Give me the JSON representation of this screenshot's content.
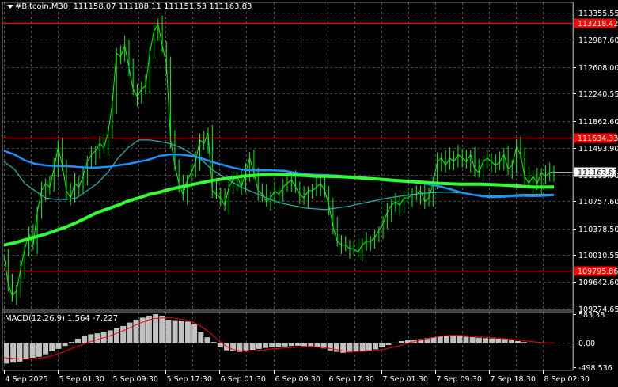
{
  "header": {
    "symbol": "#Bitcoin,M30",
    "ohlc": "111158.07 111188.11 111151.53 111163.83"
  },
  "macd_panel": {
    "label": "MACD(12,26,9) 1.564 -7.227"
  },
  "colors": {
    "background": "#000000",
    "grid": "#c0c0c0",
    "price": "#00ff00",
    "ma_fast": "#1e90ff",
    "ma_mid": "#20b2aa",
    "ma_slow": "#32ff32",
    "level": "#ff0000",
    "macd_hist": "#c0c0c0",
    "macd_signal": "#ff0000"
  },
  "chart_data": [
    {
      "type": "line",
      "name": "price",
      "y_ticks": [
        "113355.55",
        "112987.60",
        "112608.00",
        "112240.55",
        "111862.60",
        "111493.90",
        "111115.90",
        "110757.60",
        "110378.50",
        "110010.55",
        "109642.60",
        "109274.65"
      ],
      "y_tick_values": [
        113355.55,
        112987.6,
        112608.0,
        112240.55,
        111862.6,
        111493.9,
        111115.9,
        110757.6,
        110378.5,
        110010.55,
        109642.6,
        109274.65
      ],
      "ylim": [
        109250,
        113500
      ],
      "x_labels": [
        "4 Sep 2025",
        "5 Sep 01:30",
        "5 Sep 09:30",
        "5 Sep 17:30",
        "6 Sep 01:30",
        "6 Sep 09:30",
        "6 Sep 17:30",
        "7 Sep 01:30",
        "7 Sep 09:30",
        "7 Sep 18:30",
        "8 Sep 02:30"
      ],
      "current_price": "111163.83",
      "current_price_value": 111163.83,
      "levels": [
        {
          "label": "113218.42",
          "value": 113218.42
        },
        {
          "label": "111634.33",
          "value": 111634.33
        },
        {
          "label": "109795.86",
          "value": 109795.86
        }
      ],
      "close_series": [
        110000,
        109620,
        109450,
        109520,
        109820,
        110100,
        110300,
        110150,
        110600,
        110900,
        111000,
        110950,
        111200,
        111500,
        111250,
        110900,
        110800,
        111000,
        110950,
        111100,
        111300,
        111400,
        111450,
        111550,
        111500,
        111700,
        112100,
        112800,
        112750,
        112900,
        112600,
        112300,
        112200,
        112300,
        112350,
        112800,
        113100,
        113200,
        112900,
        112650,
        111600,
        111250,
        111000,
        110850,
        111050,
        111150,
        111300,
        111600,
        111550,
        111700,
        110900,
        110850,
        110800,
        110700,
        110950,
        111050,
        111100,
        110950,
        111150,
        111350,
        111150,
        110900,
        110850,
        110750,
        110800,
        110900,
        110850,
        110950,
        111000,
        111050,
        110950,
        110850,
        110800,
        110900,
        110900,
        110950,
        111000,
        110900,
        110700,
        110400,
        110200,
        110150,
        110150,
        110100,
        110100,
        110050,
        110150,
        110200,
        110200,
        110250,
        110350,
        110450,
        110600,
        110700,
        110750,
        110700,
        110800,
        110800,
        110850,
        110850,
        110900,
        110750,
        110800,
        111000,
        111300,
        111350,
        111250,
        111350,
        111300,
        111400,
        111350,
        111300,
        111400,
        111200,
        111150,
        111300,
        111350,
        111300,
        111250,
        111300,
        111400,
        111200,
        111250,
        111500,
        111400,
        111100,
        111000,
        111100,
        111000,
        111150,
        111100,
        111150,
        111163.83
      ],
      "ma_fast_series": [
        111450,
        111400,
        111320,
        111270,
        111250,
        111240,
        111240,
        111230,
        111220,
        111220,
        111230,
        111250,
        111270,
        111300,
        111330,
        111380,
        111400,
        111400,
        111380,
        111350,
        111300,
        111260,
        111220,
        111190,
        111180,
        111180,
        111180,
        111175,
        111150,
        111130,
        111120,
        111115,
        111110,
        111100,
        111085,
        111070,
        111055,
        111040,
        111030,
        111020,
        111010,
        110985,
        110960,
        110920,
        110880,
        110850,
        110825,
        110810,
        110815,
        110825,
        110830,
        110825,
        110830,
        110840
      ],
      "ma_mid_series": [
        111300,
        111200,
        111000,
        110900,
        110800,
        110780,
        110780,
        110800,
        110900,
        111000,
        111150,
        111350,
        111500,
        111600,
        111600,
        111580,
        111550,
        111500,
        111420,
        111330,
        111200,
        111100,
        111020,
        110940,
        110880,
        110820,
        110760,
        110720,
        110690,
        110660,
        110650,
        110640,
        110660,
        110680,
        110710,
        110740,
        110770,
        110800,
        110820,
        110840,
        110860,
        110870,
        110880,
        110880,
        110870,
        110850,
        110840,
        110830,
        110830,
        110840,
        110850,
        110850,
        110850,
        110850
      ],
      "ma_slow_series": [
        110150,
        110180,
        110220,
        110260,
        110300,
        110350,
        110400,
        110460,
        110530,
        110600,
        110650,
        110700,
        110760,
        110800,
        110850,
        110880,
        110920,
        110950,
        110980,
        111010,
        111040,
        111060,
        111080,
        111100,
        111110,
        111120,
        111120,
        111120,
        111115,
        111110,
        111100,
        111100,
        111095,
        111090,
        111080,
        111070,
        111060,
        111050,
        111040,
        111030,
        111020,
        111010,
        111000,
        110995,
        110990,
        110990,
        110990,
        110985,
        110980,
        110970,
        110960,
        110950,
        110950,
        110950
      ]
    },
    {
      "type": "bar",
      "name": "MACD",
      "y_ticks": [
        "583.38",
        "0.00",
        "-498.536"
      ],
      "y_tick_values": [
        583.38,
        0.0,
        -498.536
      ],
      "ylim": [
        -560,
        640
      ],
      "histogram": [
        -420,
        -400,
        -380,
        -330,
        -300,
        -280,
        -230,
        -170,
        -120,
        -60,
        20,
        90,
        150,
        180,
        200,
        230,
        260,
        300,
        350,
        420,
        480,
        520,
        560,
        590,
        560,
        480,
        470,
        460,
        440,
        380,
        220,
        120,
        20,
        -90,
        -150,
        -170,
        -180,
        -150,
        -140,
        -120,
        -100,
        -90,
        -80,
        -70,
        -60,
        -55,
        -60,
        -70,
        -90,
        -110,
        -150,
        -180,
        -200,
        -190,
        -170,
        -160,
        -150,
        -130,
        -90,
        -40,
        10,
        40,
        60,
        70,
        80,
        100,
        120,
        140,
        150,
        160,
        150,
        130,
        120,
        110,
        100,
        95,
        90,
        80,
        60,
        40,
        20,
        10,
        0,
        -5,
        2
      ],
      "signal": [
        -300,
        -310,
        -320,
        -330,
        -330,
        -320,
        -300,
        -270,
        -230,
        -190,
        -130,
        -80,
        -30,
        20,
        60,
        100,
        140,
        190,
        240,
        300,
        360,
        420,
        470,
        500,
        510,
        520,
        510,
        490,
        460,
        420,
        350,
        260,
        150,
        30,
        -70,
        -130,
        -160,
        -170,
        -165,
        -150,
        -135,
        -120,
        -110,
        -100,
        -90,
        -80,
        -70,
        -70,
        -80,
        -95,
        -115,
        -140,
        -165,
        -175,
        -175,
        -170,
        -160,
        -150,
        -130,
        -100,
        -70,
        -30,
        10,
        40,
        70,
        100,
        125,
        145,
        155,
        160,
        155,
        145,
        135,
        125,
        115,
        105,
        95,
        85,
        70,
        55,
        40,
        25,
        10,
        5,
        3
      ]
    }
  ]
}
